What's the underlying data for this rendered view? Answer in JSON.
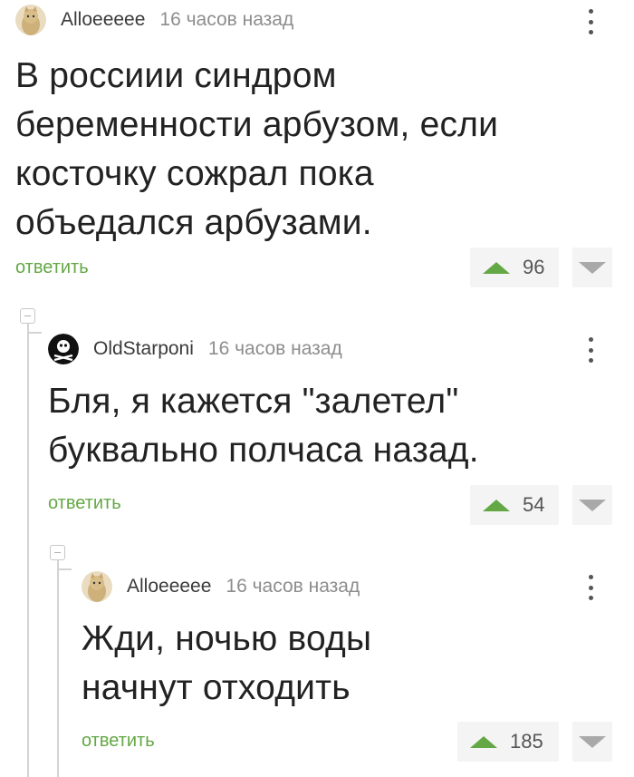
{
  "comments": [
    {
      "username": "Alloeeeee",
      "time": "16 часов назад",
      "avatar": "cat-avatar",
      "text_lines": [
        "В россиии синдром",
        "беременности арбузом, если",
        "косточку сожрал пока",
        "объедался арбузами."
      ],
      "reply_label": "ответить",
      "rating": "96"
    },
    {
      "username": "OldStarponi",
      "time": "16 часов назад",
      "avatar": "pirate-avatar",
      "text_lines": [
        "Бля, я кажется \"залетел\"",
        "буквально полчаса назад."
      ],
      "reply_label": "ответить",
      "rating": "54"
    },
    {
      "username": "Alloeeeee",
      "time": "16 часов назад",
      "avatar": "cat-avatar",
      "text_lines": [
        "Жди, ночью воды",
        "начнут отходить"
      ],
      "reply_label": "ответить",
      "rating": "185"
    }
  ],
  "colors": {
    "accent": "#63a845",
    "muted": "#8d8d8d",
    "rating_bg": "#f4f4f4"
  },
  "icons": [
    "more-vertical-icon",
    "upvote-icon",
    "downvote-icon",
    "collapse-icon"
  ]
}
